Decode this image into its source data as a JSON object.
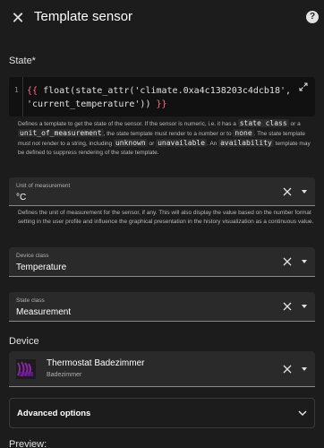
{
  "header": {
    "title": "Template sensor",
    "help_icon": "question-circle-icon",
    "close_icon": "close-icon"
  },
  "state": {
    "label": "State*",
    "line_number": "1",
    "code_open": "{{",
    "code_body": " float(state_attr('climate.0xa4c138203c4dcb18', 'current_temperature')) ",
    "code_close": "}}",
    "helper_parts": {
      "p1": "Defines a template to get the state of the sensor. If the sensor is numeric, i.e. it has a ",
      "c1": "state class",
      "p2": " or a ",
      "c2": "unit_of_measurement",
      "p3": ", the state template must render to a number or to ",
      "c3": "none",
      "p4": ". The state template must not render to a string, including ",
      "c4": "unknown",
      "p5": " or ",
      "c5": "unavailable",
      "p6": ". An ",
      "c6": "availability",
      "p7": " template may be defined to suppress rendering of the state template."
    }
  },
  "unit": {
    "label": "Unit of measurement",
    "value": "°C",
    "helper": "Defines the unit of measurement for the sensor, if any. This will also display the value based on the number format setting in the user profile and influence the graphical presentation in the history visualization as a continuous value."
  },
  "device_class": {
    "label": "Device class",
    "value": "Temperature"
  },
  "state_class": {
    "label": "State class",
    "value": "Measurement"
  },
  "device": {
    "section_label": "Device",
    "name": "Thermostat Badezimmer",
    "area": "Badezimmer",
    "icon_color": "#7b1fa2"
  },
  "advanced": {
    "label": "Advanced options"
  },
  "preview": {
    "label": "Preview:"
  },
  "colors": {
    "background": "#1c1c1c",
    "field": "#2a2a2a",
    "template_brace": "#ff6b8b"
  }
}
